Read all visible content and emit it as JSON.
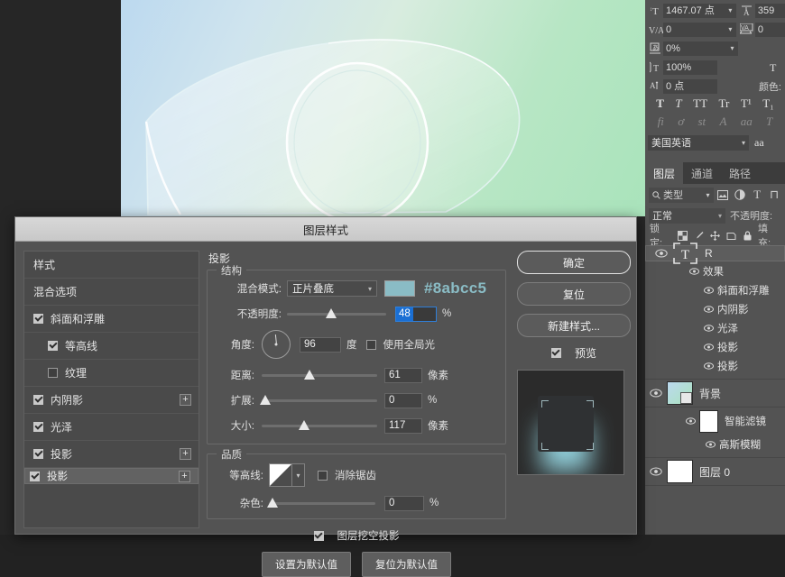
{
  "app": {
    "dialog_title": "图层样式"
  },
  "character_panel": {
    "rows": [
      {
        "icon": "font-size-icon",
        "value": "1467.07 点",
        "icon2": "leading-icon",
        "value2": "359"
      },
      {
        "icon": "kerning-icon",
        "value": "0",
        "icon2": "tracking-icon",
        "value2": "0"
      },
      {
        "icon": "vertical-scale-icon",
        "value": "0%"
      },
      {
        "icon": "horizontal-scale-icon",
        "value": "100%"
      },
      {
        "icon": "baseline-shift-icon",
        "value": "0 点"
      }
    ],
    "color_label": "颜色:",
    "style_buttons_row1": [
      "T",
      "T",
      "TT",
      "Tr",
      "T¹",
      "T₁"
    ],
    "style_buttons_row2": [
      "fi",
      "ơ",
      "st",
      "A",
      "aa",
      "T"
    ],
    "language": "美国英语",
    "anti_alias_icon": "aa"
  },
  "layers_panel": {
    "tabs": [
      {
        "label": "图层",
        "active": true
      },
      {
        "label": "通道",
        "active": false
      },
      {
        "label": "路径",
        "active": false
      }
    ],
    "filter_placeholder": "类型",
    "filter_icons": [
      "image-filter-icon",
      "adjustment-filter-icon",
      "text-filter-icon",
      "shape-filter-icon"
    ],
    "blend_mode": "正常",
    "opacity_label": "不透明度:",
    "lock_label": "锁定:",
    "lock_icons": [
      "transparency-lock-icon",
      "brush-lock-icon",
      "move-lock-icon",
      "artboard-lock-icon",
      "all-lock-icon"
    ],
    "fill_label": "填充:",
    "layers": [
      {
        "name": "R",
        "type": "text",
        "selected": true,
        "visible": true,
        "effects_group": "效果",
        "effects": [
          "斜面和浮雕",
          "内阴影",
          "光泽",
          "投影",
          "投影"
        ]
      },
      {
        "name": "背景",
        "type": "image",
        "selected": false,
        "visible": true,
        "smart_filters_label": "智能滤镜",
        "smart_filters": [
          "高斯模糊"
        ]
      },
      {
        "name": "图层 0",
        "type": "blank",
        "selected": false,
        "visible": true
      }
    ]
  },
  "dialog": {
    "styles_list": [
      {
        "label": "样式",
        "checkbox": null,
        "indent": false,
        "plus": false,
        "selected": false
      },
      {
        "label": "混合选项",
        "checkbox": null,
        "indent": false,
        "plus": false,
        "selected": false
      },
      {
        "label": "斜面和浮雕",
        "checkbox": true,
        "indent": false,
        "plus": false,
        "selected": false
      },
      {
        "label": "等高线",
        "checkbox": true,
        "indent": true,
        "plus": false,
        "selected": false
      },
      {
        "label": "纹理",
        "checkbox": false,
        "indent": true,
        "plus": false,
        "selected": false
      },
      {
        "label": "内阴影",
        "checkbox": true,
        "indent": false,
        "plus": true,
        "selected": false
      },
      {
        "label": "光泽",
        "checkbox": true,
        "indent": false,
        "plus": false,
        "selected": false
      },
      {
        "label": "投影",
        "checkbox": true,
        "indent": false,
        "plus": true,
        "selected": false
      },
      {
        "label": "投影",
        "checkbox": true,
        "indent": false,
        "plus": true,
        "selected": true
      }
    ],
    "section_title": "投影",
    "structure": {
      "legend": "结构",
      "blend_mode_label": "混合模式:",
      "blend_mode_value": "正片叠底",
      "color_hex": "#8abcc5",
      "opacity_label": "不透明度:",
      "opacity_value": "48",
      "opacity_unit": "%",
      "angle_label": "角度:",
      "angle_value": "96",
      "angle_unit": "度",
      "global_light_label": "使用全局光",
      "global_light_checked": false,
      "distance_label": "距离:",
      "distance_value": "61",
      "distance_unit": "像素",
      "spread_label": "扩展:",
      "spread_value": "0",
      "spread_unit": "%",
      "size_label": "大小:",
      "size_value": "117",
      "size_unit": "像素"
    },
    "quality": {
      "legend": "品质",
      "contour_label": "等高线:",
      "antialias_label": "消除锯齿",
      "antialias_checked": false,
      "noise_label": "杂色:",
      "noise_value": "0",
      "noise_unit": "%"
    },
    "knockout_label": "图层挖空投影",
    "knockout_checked": true,
    "set_default_label": "设置为默认值",
    "reset_default_label": "复位为默认值",
    "buttons": {
      "ok": "确定",
      "reset": "复位",
      "new_style": "新建样式...",
      "preview_label": "预览",
      "preview_checked": true
    }
  }
}
